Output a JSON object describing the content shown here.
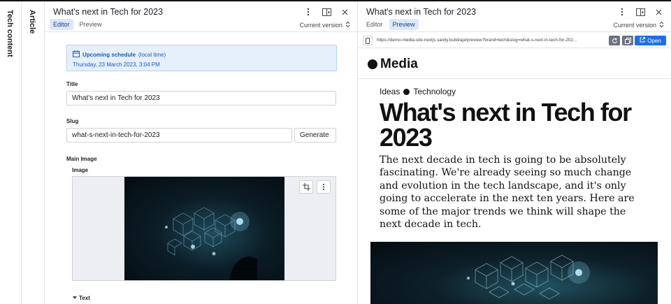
{
  "rails": {
    "tech_content": "Tech content",
    "article": "Article"
  },
  "editor_pane": {
    "title": "What's next in Tech for 2023",
    "tabs": [
      "Editor",
      "Preview"
    ],
    "active_tab": "Editor",
    "version": "Current version",
    "schedule": {
      "label": "Upcoming schedule",
      "note": "(local time)",
      "date": "Thursday, 23 March 2023, 3:04 PM"
    },
    "fields": {
      "title_label": "Title",
      "title_value": "What's next in Tech for 2023",
      "slug_label": "Slug",
      "slug_value": "what-s-next-in-tech-for-2023",
      "generate_button": "Generate",
      "main_image_label": "Main Image",
      "image_label": "Image",
      "text_label": "Text"
    }
  },
  "preview_pane": {
    "title": "What's next in Tech for 2023",
    "tabs": [
      "Editor",
      "Preview"
    ],
    "active_tab": "Preview",
    "version": "Current version",
    "url": "https://demo-media-site-nextjs.sanity.build/api/preview?brand=tech&slug=what-s-next-in-tech-for-202...",
    "open_button": "Open",
    "site": {
      "brand": "Media",
      "crumbs": [
        "Ideas",
        "Technology"
      ],
      "headline": "What's next in Tech for 2023",
      "lede": "The next decade in tech is going to be absolutely fascinating. We're already seeing so much change and evolution in the tech landscape, and it's only going to accelerate in the next ten years. Here are some of the major trends we think will shape the next decade in tech."
    }
  },
  "icons": [
    "more-icon",
    "split-pane-icon",
    "close-icon",
    "chevron-updown-icon",
    "calendar-icon",
    "crop-icon",
    "device-icon",
    "refresh-icon",
    "copy-icon",
    "external-link-icon",
    "chevron-down-icon"
  ],
  "colors": {
    "accent": "#1f6ee8",
    "schedule_bg": "#e6f0fd",
    "schedule_text": "#1f5ab8",
    "active_tab_bg": "#dbe8fb"
  }
}
